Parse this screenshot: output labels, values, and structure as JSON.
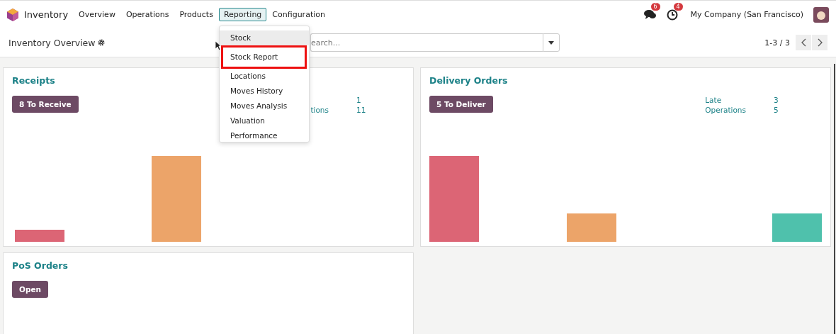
{
  "navbar": {
    "app_name": "Inventory",
    "menus": [
      {
        "label": "Overview",
        "selected": false
      },
      {
        "label": "Operations",
        "selected": false
      },
      {
        "label": "Products",
        "selected": false
      },
      {
        "label": "Reporting",
        "selected": true
      },
      {
        "label": "Configuration",
        "selected": false
      }
    ],
    "messages_badge": "6",
    "activities_badge": "4",
    "company": "My Company (San Francisco)"
  },
  "control_panel": {
    "title": "Inventory Overview",
    "search": {
      "placeholder": "earch..."
    },
    "pager": "1-3 / 3"
  },
  "reporting_menu": [
    {
      "label": "Stock",
      "hovered": true,
      "highlighted": false
    },
    {
      "label": "Stock Report",
      "hovered": false,
      "highlighted": true
    },
    {
      "label": "Locations",
      "hovered": false,
      "highlighted": false
    },
    {
      "label": "Moves History",
      "hovered": false,
      "highlighted": false
    },
    {
      "label": "Moves Analysis",
      "hovered": false,
      "highlighted": false
    },
    {
      "label": "Valuation",
      "hovered": false,
      "highlighted": false
    },
    {
      "label": "Performance",
      "hovered": false,
      "highlighted": false
    }
  ],
  "cards": [
    {
      "title": "Receipts",
      "button": "8 To Receive",
      "stats": [
        {
          "value": "1"
        },
        {
          "label": "tions",
          "value": "11"
        }
      ],
      "kind": "receipts"
    },
    {
      "title": "Delivery Orders",
      "button": "5 To Deliver",
      "stats": [
        {
          "label": "Late",
          "value": "3"
        },
        {
          "label": "Operations",
          "value": "5"
        }
      ],
      "kind": "delivery"
    },
    {
      "title": "PoS Orders",
      "button": "Open",
      "kind": "pos"
    }
  ]
}
